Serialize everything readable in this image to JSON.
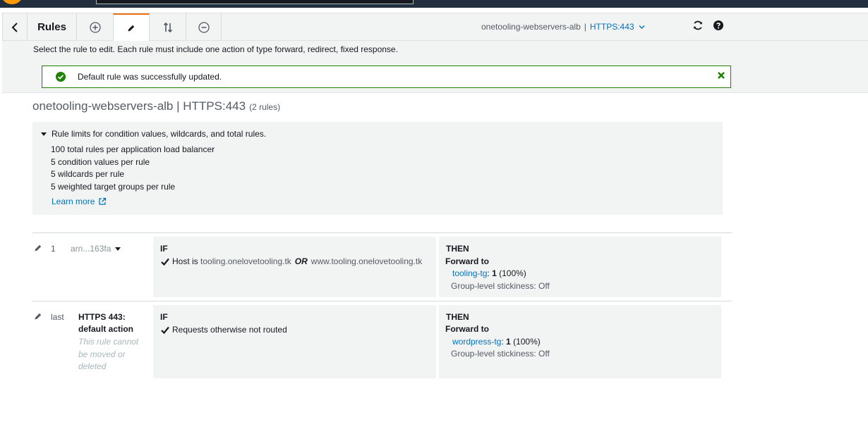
{
  "toolbar": {
    "title": "Rules",
    "load_balancer": "onetooling-webservers-alb",
    "separator": "|",
    "listener": "HTTPS:443"
  },
  "band": {
    "instruction": "Select the rule to edit. Each rule must include one action of type forward, redirect, fixed response.",
    "flash_message": "Default rule was successfully updated."
  },
  "heading": {
    "title": "onetooling-webservers-alb | HTTPS:443",
    "count": "(2 rules)"
  },
  "limits": {
    "toggle_label": "Rule limits for condition values, wildcards, and total rules.",
    "items": [
      "100 total rules per application load balancer",
      "5 condition values per rule",
      "5 wildcards per rule",
      "5 weighted target groups per rule"
    ],
    "learn_more": "Learn more"
  },
  "rules": [
    {
      "number": "1",
      "arn": "arn...163fa",
      "if_label": "IF",
      "condition_prefix": "Host is",
      "condition_value_1": "tooling.onelovetooling.tk",
      "condition_or": "OR",
      "condition_value_2": "www.tooling.onelovetooling.tk",
      "then_label": "THEN",
      "action": "Forward to",
      "target_group": "tooling-tg",
      "target_sep": ":",
      "weight": "1",
      "weight_pct": "(100%)",
      "stickiness": "Group-level stickiness: Off"
    },
    {
      "number": "last",
      "title_line1": "HTTPS 443:",
      "title_line2": "default action",
      "note": "This rule cannot be moved or deleted",
      "if_label": "IF",
      "condition": "Requests otherwise not routed",
      "then_label": "THEN",
      "action": "Forward to",
      "target_group": "wordpress-tg",
      "target_sep": ":",
      "weight": "1",
      "weight_pct": "(100%)",
      "stickiness": "Group-level stickiness: Off"
    }
  ],
  "colors": {
    "link": "#0073bb",
    "success": "#1d8102",
    "accent": "#ec7211",
    "panel": "#f2f3f3",
    "header_dark": "#232f3e"
  }
}
